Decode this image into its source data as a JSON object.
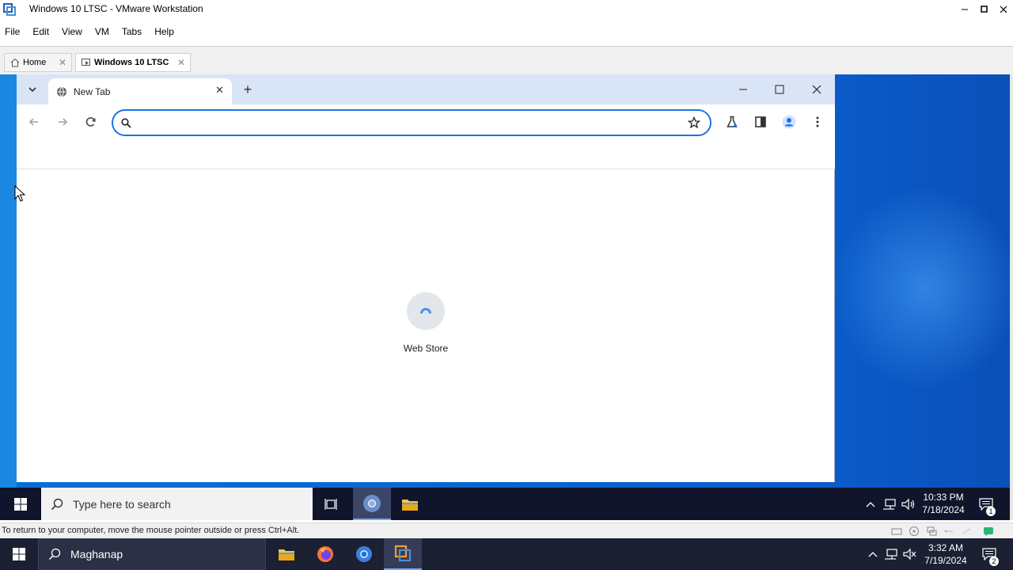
{
  "vmware": {
    "window_title": "Windows 10 LTSC - VMware Workstation",
    "menus": [
      {
        "label": "File"
      },
      {
        "label": "Edit"
      },
      {
        "label": "View"
      },
      {
        "label": "VM"
      },
      {
        "label": "Tabs"
      },
      {
        "label": "Help"
      }
    ],
    "tabs": [
      {
        "label": "Home",
        "icon": "home-icon",
        "active": false
      },
      {
        "label": "Windows 10 LTSC",
        "icon": "vm-icon",
        "active": true
      }
    ],
    "status_text": "To return to your computer, move the mouse pointer outside or press Ctrl+Alt."
  },
  "chrome": {
    "tab_title": "New Tab",
    "omnibox_value": "",
    "shortcut": {
      "label": "Web Store"
    },
    "accent_color": "#1a73e8"
  },
  "guest_taskbar": {
    "search_placeholder": "Type here to search",
    "time": "10:33 PM",
    "date": "7/18/2024",
    "notification_count": "1"
  },
  "host_taskbar": {
    "search_text": "Maghanap",
    "time": "3:32 AM",
    "date": "7/19/2024",
    "notification_count": "2"
  }
}
